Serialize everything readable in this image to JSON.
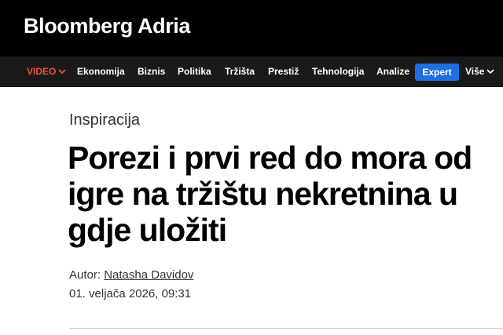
{
  "brand": {
    "logo_text": "Bloomberg Adria"
  },
  "nav": {
    "items": [
      {
        "label": "VIDEO"
      },
      {
        "label": "Ekonomija"
      },
      {
        "label": "Biznis"
      },
      {
        "label": "Politika"
      },
      {
        "label": "Tržišta"
      },
      {
        "label": "Prestiž"
      },
      {
        "label": "Tehnologija"
      },
      {
        "label": "Analize"
      },
      {
        "label": "Expert"
      },
      {
        "label": "Više"
      }
    ],
    "video_color": "#f24e3a",
    "expert_color": "#1f6fe0"
  },
  "article": {
    "category": "Inspiracija",
    "title_lines": [
      "Porezi i prvi red do mora od",
      "igre na tržištu nekretnina u",
      "gdje uložiti"
    ],
    "author_label": "Autor:",
    "author_name": "Natasha Davidov",
    "date": "01. veljača 2026, 09:31"
  },
  "icons": {
    "video_dropdown": "chevron-down-icon",
    "more_dropdown": "chevron-down-icon"
  }
}
